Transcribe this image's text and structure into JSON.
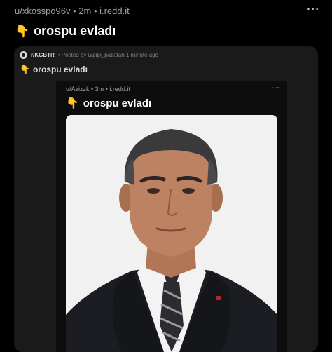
{
  "post": {
    "meta": "u/xkosspo96v • 2m • i.redd.it",
    "emoji": "👇",
    "title": "orospu evladı"
  },
  "embed": {
    "subreddit": "r/KGBTR",
    "meta": "• Posted by u/pipi_patlatan 1 minute ago",
    "emoji": "👇",
    "title": "orospu evladı",
    "inner": {
      "meta": "u/Azizzk • 3m • i.redd.it",
      "emoji": "👇",
      "title": "orospu evladı"
    }
  },
  "icons": {
    "more": "⋮",
    "subreddit_icon": "subreddit-icon",
    "photo": "portrait-photo"
  }
}
